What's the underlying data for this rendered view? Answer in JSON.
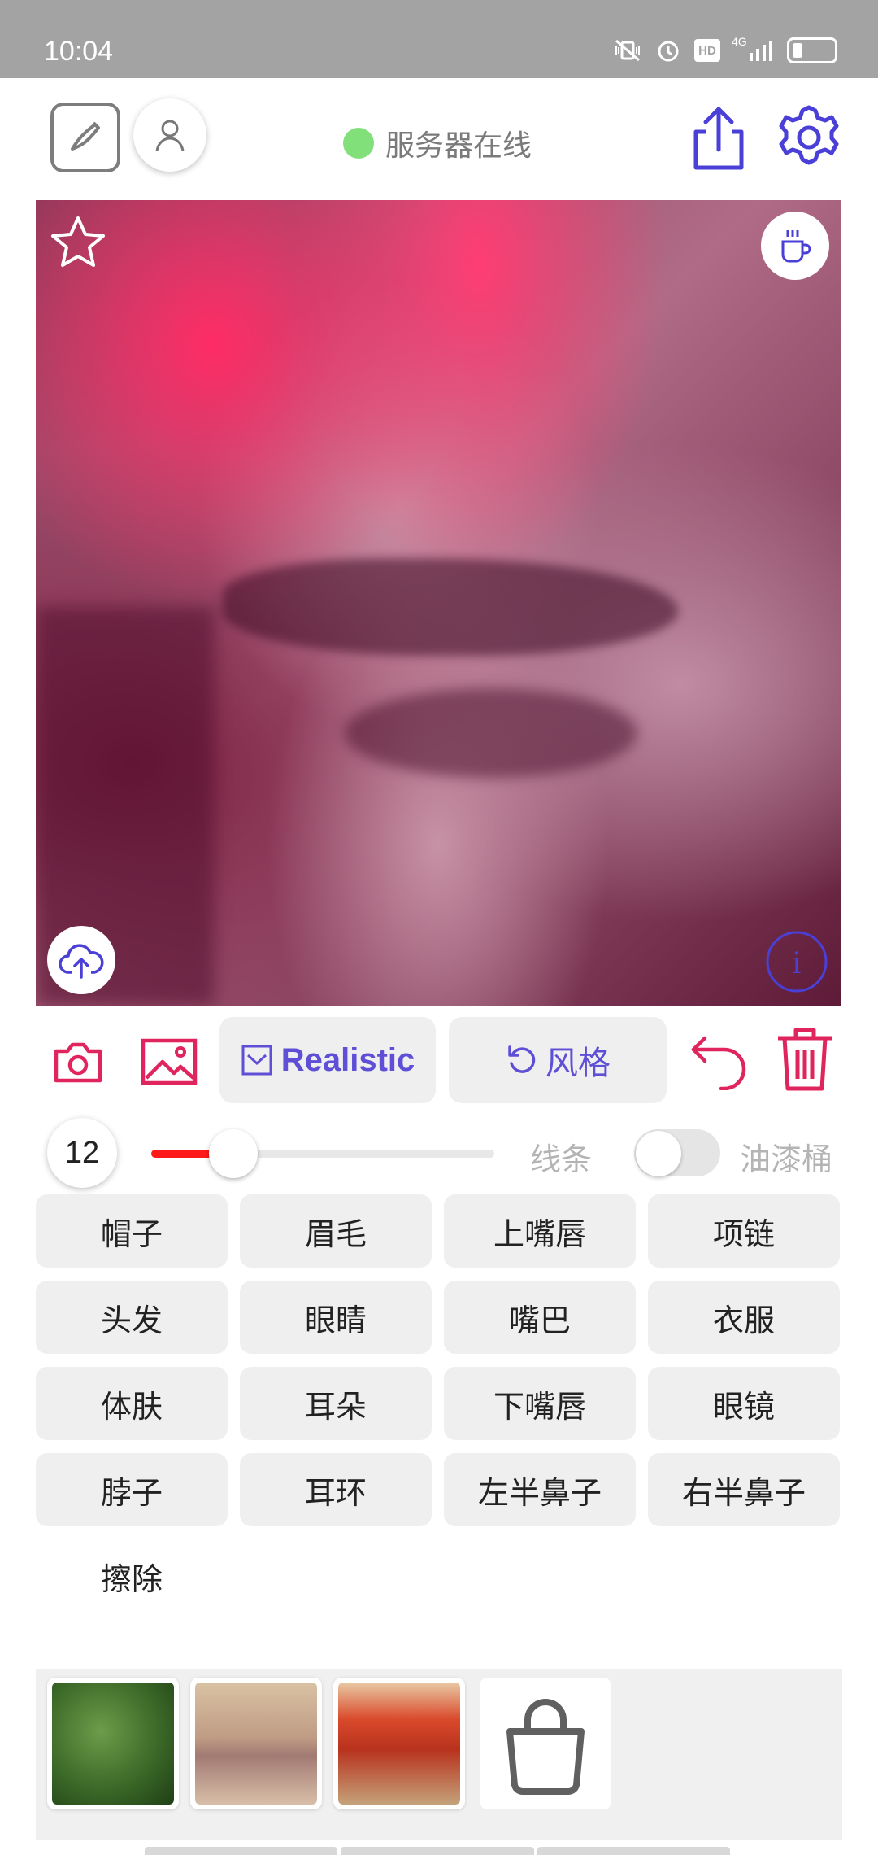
{
  "status_bar": {
    "time": "10:04",
    "icons": [
      "vibrate-silent-icon",
      "alarm-icon",
      "hd-icon",
      "4g-signal-icon",
      "battery-icon"
    ],
    "hd_label": "HD",
    "network_label": "4G",
    "battery_level": 0.22
  },
  "header": {
    "server_status": "服务器在线",
    "status_color": "#82e07a",
    "accent_color": "#4a3fd6"
  },
  "toolbar": {
    "realistic_label": "Realistic",
    "style_label": "风格",
    "accent_color": "#5e4fd6",
    "danger_color": "#e0245e"
  },
  "brush": {
    "size": "12",
    "slider_fraction": 0.18,
    "line_label": "线条",
    "bucket_label": "油漆桶",
    "bucket_enabled": false
  },
  "parts": [
    "帽子",
    "眉毛",
    "上嘴唇",
    "项链",
    "头发",
    "眼睛",
    "嘴巴",
    "衣服",
    "体肤",
    "耳朵",
    "下嘴唇",
    "眼镜",
    "脖子",
    "耳环",
    "左半鼻子",
    "右半鼻子",
    "擦除"
  ],
  "gallery": {
    "items": [
      "forest-texture",
      "floral-texture",
      "red-flower-texture"
    ],
    "store_icon": "shopping-bag-icon"
  }
}
